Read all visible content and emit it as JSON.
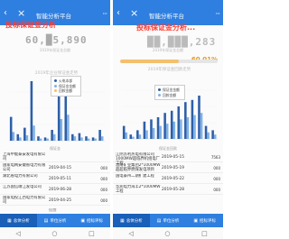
{
  "colors": {
    "accent": "#2f7fe0",
    "overlay_text": "#ff3b30",
    "bar_dark": "#2e5fa8",
    "bar_light": "#7fb2e6",
    "progress_fill": "#f4bf6e",
    "pct_text": "#e39a1d"
  },
  "icons": {
    "back": "back-arrow-icon",
    "close": "close-icon",
    "more": "more-dots-icon",
    "chart_tab": "bar-chart-icon",
    "unit_tab": "building-icon",
    "evaluate_tab": "clipboard-icon",
    "nav_back": "nav-back-icon",
    "nav_home": "nav-home-icon",
    "nav_recent": "nav-recent-icon"
  },
  "left": {
    "app_title": "智能分析平台",
    "overlay_text": "投标保证金分析",
    "big_number": "60,█5,890",
    "caption": "2019年保证金总额",
    "section_label": "2019年企业保证金走势",
    "legend": [
      {
        "label": "火电本部",
        "color": "#2e5fa8"
      },
      {
        "label": "保证金金额",
        "color": "#7fb2e6"
      }
    ],
    "legend_item": "回款金额",
    "x_axis_label": "保证金",
    "chart_data": {
      "type": "bar",
      "categories": [
        "1",
        "2",
        "3",
        "4",
        "5",
        "6",
        "7",
        "8",
        "9",
        "10",
        "11",
        "12",
        "13",
        "14"
      ],
      "series": [
        {
          "values": [
            22,
            6,
            12,
            55,
            4,
            3,
            10,
            46,
            52,
            6,
            7,
            4,
            3,
            10
          ]
        },
        {
          "values": [
            8,
            3,
            5,
            14,
            2,
            2,
            6,
            20,
            24,
            4,
            3,
            2,
            2,
            4
          ]
        }
      ],
      "ylim": [
        0,
        60
      ]
    },
    "rows": [
      {
        "name": "上海申能泰安发电有限公司",
        "date": "",
        "extra": ""
      },
      {
        "name": "国家电网安徽省电力有限公司",
        "date": "2019-04-15",
        "extra": "000"
      },
      {
        "name": "湖北省电力有限公司",
        "date": "2019-05-11",
        "extra": "000"
      },
      {
        "name": "江苏国信靖江发电公司",
        "date": "2019-06-28",
        "extra": "000"
      },
      {
        "name": "国家电投江西电力有限公司",
        "date": "2019-04-25",
        "extra": "000"
      }
    ],
    "footer_note": "提醒",
    "tabs": [
      {
        "label": "总体分析",
        "active": true
      },
      {
        "label": "单位分析",
        "active": false
      },
      {
        "label": "招标评标",
        "active": false
      }
    ]
  },
  "right": {
    "app_title": "智能分析平台",
    "overlay_text": "投标保证金分析...",
    "big_number": "██,███,283",
    "caption": "2019年保证金总额",
    "pct": "60.01%",
    "progress": 60.01,
    "section_label": "2019年保证金回款走势",
    "legend": [
      {
        "label": "保证金金额",
        "color": "#2e5fa8"
      },
      {
        "label": "回款金额",
        "color": "#7fb2e6"
      }
    ],
    "x_axis_label": "保证金回款",
    "chart_data": {
      "type": "bar",
      "categories": [
        "1",
        "2",
        "3",
        "4",
        "5",
        "6",
        "7",
        "8",
        "9",
        "10",
        "11",
        "12",
        "13",
        "14"
      ],
      "series": [
        {
          "values": [
            12,
            4,
            8,
            16,
            18,
            20,
            24,
            26,
            30,
            34,
            36,
            40,
            12,
            8
          ]
        },
        {
          "values": [
            6,
            2,
            4,
            8,
            10,
            12,
            14,
            16,
            18,
            20,
            22,
            24,
            6,
            4
          ]
        }
      ],
      "ylim": [
        0,
        60
      ]
    },
    "rows": [
      {
        "name": "江阴苏利热电有限公司1000MW超临界机组电厂工程",
        "date": "2019-05-15",
        "extra": "7563"
      },
      {
        "name": "淮南矿业集团2*1000MW超超临界燃煤发电项目",
        "date": "2019-05-19",
        "extra": "000"
      },
      {
        "name": "国电泰州二期扩建工程",
        "date": "2019-05-22",
        "extra": "000"
      },
      {
        "name": "华润电力海丰2*1000MW工程",
        "date": "2019-05-28",
        "extra": "000"
      }
    ],
    "tabs": [
      {
        "label": "总体分析",
        "active": true
      },
      {
        "label": "单位分析",
        "active": false
      },
      {
        "label": "招标评标",
        "active": false
      }
    ]
  }
}
